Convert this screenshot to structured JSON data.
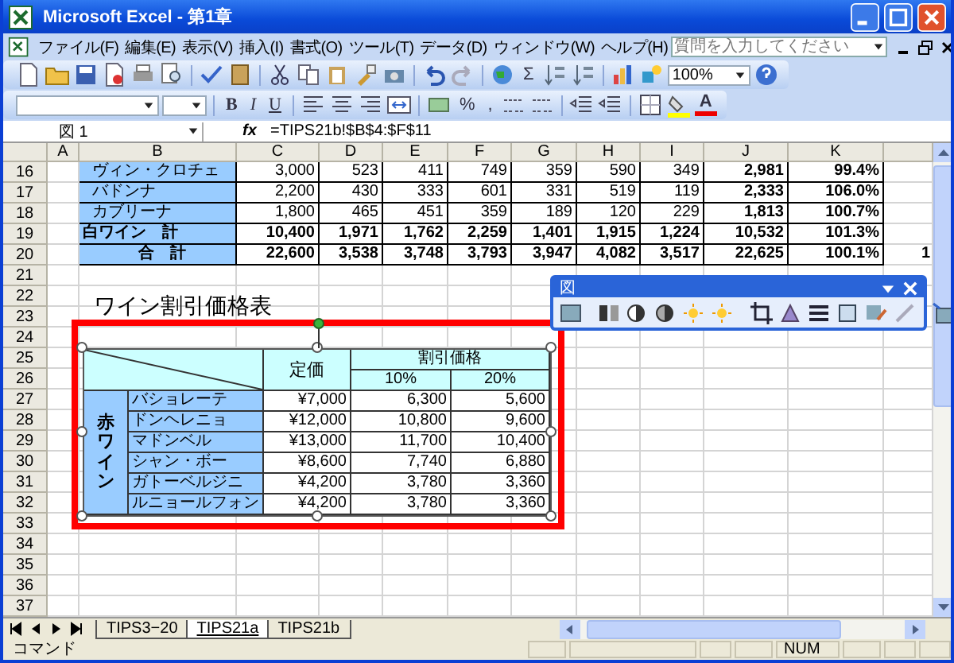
{
  "window": {
    "title": "Microsoft Excel - 第1章"
  },
  "menu": [
    "ファイル(F)",
    "編集(E)",
    "表示(V)",
    "挿入(I)",
    "書式(O)",
    "ツール(T)",
    "データ(D)",
    "ウィンドウ(W)",
    "ヘルプ(H)"
  ],
  "help_search": {
    "placeholder": "質問を入力してください"
  },
  "standard_toolbar": {
    "sum": "Σ",
    "zoom": "100%"
  },
  "format_toolbar": {
    "bold": "B",
    "italic": "I",
    "underline": "U",
    "percent": "%",
    "comma": ",",
    "font_color": "A"
  },
  "formula_bar": {
    "name_box": "図 1",
    "fx": "fx",
    "formula": "=TIPS21b!$B$4:$F$11"
  },
  "sheet": {
    "columns": [
      "A",
      "B",
      "C",
      "D",
      "E",
      "F",
      "G",
      "H",
      "I",
      "J",
      "K"
    ],
    "rows": [
      {
        "number": "16",
        "kind": "item",
        "label": "ヴィン・クロチェ",
        "values": [
          "3,000",
          "523",
          "411",
          "749",
          "359",
          "590",
          "349",
          "2,981",
          "99.4%"
        ]
      },
      {
        "number": "17",
        "kind": "item",
        "label": "バドンナ",
        "values": [
          "2,200",
          "430",
          "333",
          "601",
          "331",
          "519",
          "119",
          "2,333",
          "106.0%"
        ]
      },
      {
        "number": "18",
        "kind": "item",
        "label": "カブリーナ",
        "values": [
          "1,800",
          "465",
          "451",
          "359",
          "189",
          "120",
          "229",
          "1,813",
          "100.7%"
        ]
      },
      {
        "number": "19",
        "kind": "subtotal",
        "label": "白ワイン　計",
        "values": [
          "10,400",
          "1,971",
          "1,762",
          "2,259",
          "1,401",
          "1,915",
          "1,224",
          "10,532",
          "101.3%"
        ]
      },
      {
        "number": "20",
        "kind": "total",
        "label": "合　計",
        "values": [
          "22,600",
          "3,538",
          "3,748",
          "3,793",
          "3,947",
          "4,082",
          "3,517",
          "22,625",
          "100.1%"
        ],
        "column_l": "1"
      }
    ],
    "empty_rows": [
      "21",
      "22",
      "23",
      "24",
      "25",
      "26",
      "27",
      "28",
      "29",
      "30",
      "31",
      "32",
      "33",
      "34",
      "35",
      "36",
      "37"
    ],
    "title": "ワイン割引価格表"
  },
  "picture": {
    "price_header": "定価",
    "discount_header": "割引価格",
    "rate_headers": [
      "10%",
      "20%"
    ],
    "group_label": "赤ワイン",
    "rows": [
      {
        "name": "バショレーテ",
        "price": "¥7,000",
        "values": [
          "6,300",
          "5,600"
        ]
      },
      {
        "name": "ドンヘレニョ",
        "price": "¥12,000",
        "values": [
          "10,800",
          "9,600"
        ]
      },
      {
        "name": "マドンベル",
        "price": "¥13,000",
        "values": [
          "11,700",
          "10,400"
        ]
      },
      {
        "name": "シャン・ボー",
        "price": "¥8,600",
        "values": [
          "7,740",
          "6,880"
        ]
      },
      {
        "name": "ガトーベルジニ",
        "price": "¥4,200",
        "values": [
          "3,780",
          "3,360"
        ]
      },
      {
        "name": "ルニョールフォン",
        "price": "¥4,200",
        "values": [
          "3,780",
          "3,360"
        ]
      }
    ]
  },
  "picture_toolbar": {
    "title": "図"
  },
  "sheet_tabs": [
    {
      "label": "TIPS3−20",
      "selected": false
    },
    {
      "label": "TIPS21a",
      "selected": true
    },
    {
      "label": "TIPS21b",
      "selected": false
    }
  ],
  "status_bar": {
    "mode": "コマンド",
    "indicator": "NUM"
  }
}
